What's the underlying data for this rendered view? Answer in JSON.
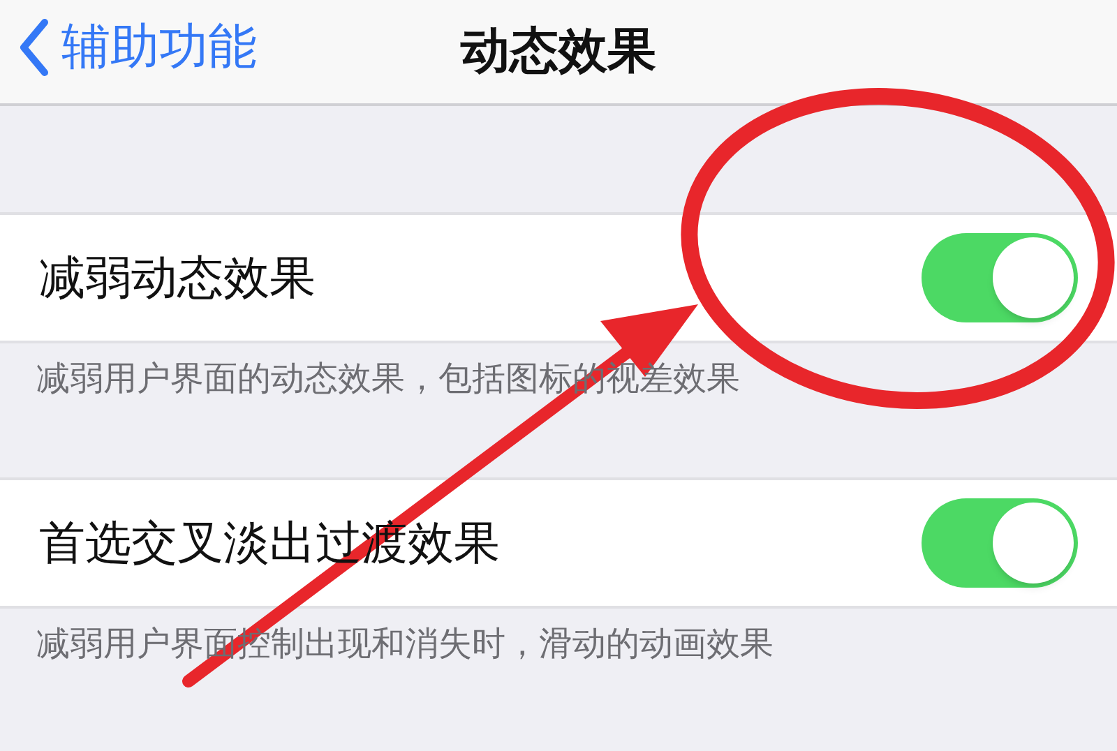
{
  "nav": {
    "back": "辅助功能",
    "title": "动态效果"
  },
  "settings": [
    {
      "label": "减弱动态效果",
      "on": true,
      "footer": "减弱用户界面的动态效果，包括图标的视差效果"
    },
    {
      "label": "首选交叉淡出过渡效果",
      "on": true,
      "footer": "减弱用户界面控制出现和消失时，滑动的动画效果"
    }
  ]
}
